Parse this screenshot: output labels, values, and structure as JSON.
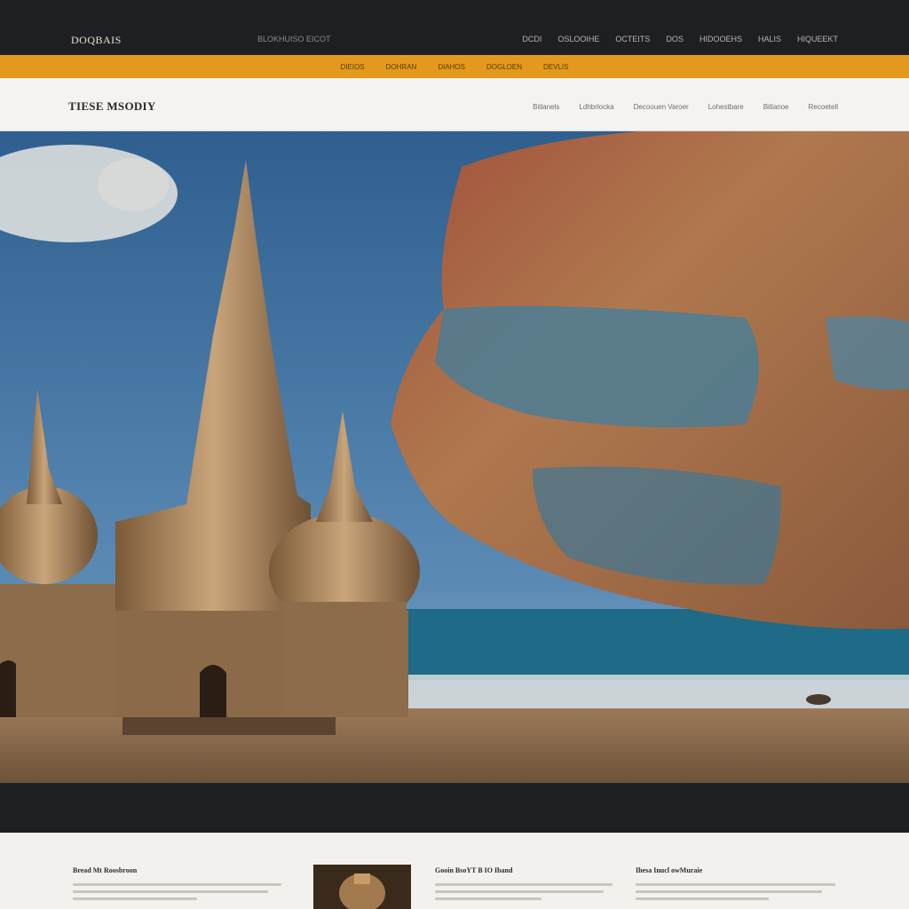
{
  "header": {
    "logo": "DOQBAIS",
    "tagline": "BLOKHUISO EICOT",
    "nav": [
      "DCDI",
      "OSLOOIHE",
      "OCTEITS",
      "DOS",
      "HIDOOEHS",
      "HALIS",
      "HIQUEEKT"
    ]
  },
  "accent_nav": [
    "DIEIOS",
    "DOHRAN",
    "DIAHOS",
    "DOGLOEN",
    "DEVLIS"
  ],
  "subheader": {
    "title": "TIESE MSODIY",
    "menu": [
      "Bitlanels",
      "Ldhbrlocka",
      "Decoouen Varoer",
      "Lohestbare",
      "Bitlanoe",
      "Recoetell"
    ]
  },
  "footer_columns": [
    {
      "heading": "Bread Mt Roosbroon"
    },
    {
      "heading": "Gooin BsoYT B IO Iband"
    },
    {
      "heading": "Ihesa Inucl owMuraie"
    }
  ],
  "colors": {
    "topbar": "#1e1f22",
    "accent": "#e39a1c",
    "sky": "#3f6f9e",
    "sea": "#2a6f87",
    "sand": "#8c6a4c"
  }
}
